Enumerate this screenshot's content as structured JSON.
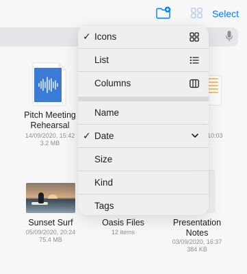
{
  "toolbar": {
    "select_label": "Select",
    "new_folder_icon": "folder-badge-plus-icon",
    "view_icon": "grid-view-icon",
    "accent_color": "#007aff"
  },
  "search": {
    "mic_icon": "microphone-icon"
  },
  "files": [
    {
      "name_line1": "Pitch Meeting",
      "name_line2": "Rehearsal",
      "date": "14/09/2020, 15:42",
      "size": "3.2 MB"
    },
    {
      "name_partial": "t",
      "meta_partial": "10:03"
    },
    {
      "name": "Sunset Surf",
      "date": "05/09/2020, 20:24",
      "size": "75.4 MB"
    },
    {
      "name": "Oasis Files",
      "count": "12 items"
    },
    {
      "name_line1": "Presentation",
      "name_line2": "Notes",
      "date": "03/09/2020, 16:37",
      "size": "384 KB"
    }
  ],
  "menu": {
    "view_options": [
      {
        "label": "Icons",
        "checked": true,
        "icon": "grid-icon"
      },
      {
        "label": "List",
        "checked": false,
        "icon": "list-icon"
      },
      {
        "label": "Columns",
        "checked": false,
        "icon": "columns-icon"
      }
    ],
    "sort_options": [
      {
        "label": "Name",
        "checked": false
      },
      {
        "label": "Date",
        "checked": true,
        "direction": "descending"
      },
      {
        "label": "Size",
        "checked": false
      },
      {
        "label": "Kind",
        "checked": false
      },
      {
        "label": "Tags",
        "checked": false
      }
    ],
    "check_glyph": "✓"
  }
}
